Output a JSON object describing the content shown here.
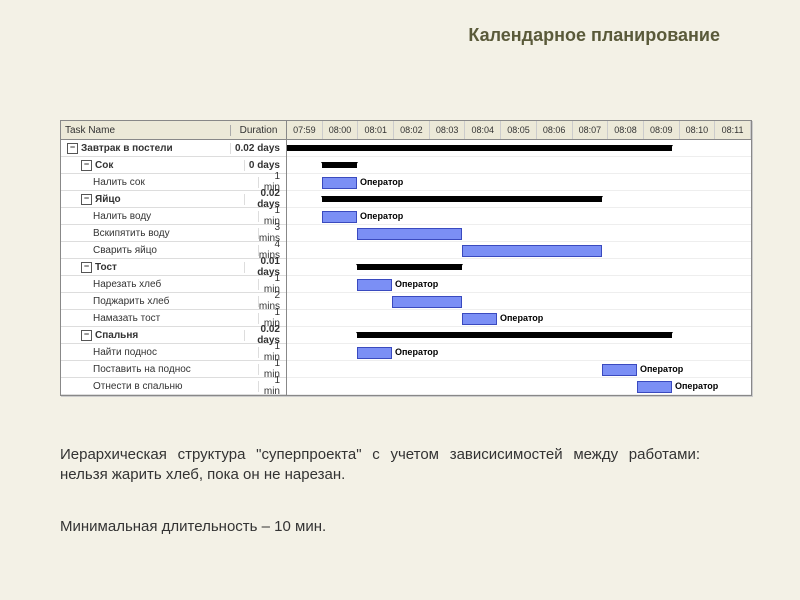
{
  "title": "Календарное планирование",
  "columns": {
    "name": "Task Name",
    "duration": "Duration"
  },
  "timeHeader": [
    "07:59",
    "08:00",
    "08:01",
    "08:02",
    "08:03",
    "08:04",
    "08:05",
    "08:06",
    "08:07",
    "08:08",
    "08:09",
    "08:10",
    "08:11"
  ],
  "resourceLabel": "Оператор",
  "tasks": [
    {
      "level": 0,
      "name": "Завтрак в постели",
      "duration": "0.02 days",
      "type": "summary",
      "start": 0,
      "len": 11
    },
    {
      "level": 1,
      "name": "Сок",
      "duration": "0 days",
      "type": "summary",
      "start": 1,
      "len": 1
    },
    {
      "level": 2,
      "name": "Налить сок",
      "duration": "1 min",
      "type": "task",
      "start": 1,
      "len": 1,
      "label": true
    },
    {
      "level": 1,
      "name": "Яйцо",
      "duration": "0.02 days",
      "type": "summary",
      "start": 1,
      "len": 8
    },
    {
      "level": 2,
      "name": "Налить воду",
      "duration": "1 min",
      "type": "task",
      "start": 1,
      "len": 1,
      "label": true
    },
    {
      "level": 2,
      "name": "Вскипятить воду",
      "duration": "3 mins",
      "type": "task",
      "start": 2,
      "len": 3
    },
    {
      "level": 2,
      "name": "Сварить яйцо",
      "duration": "4 mins",
      "type": "task",
      "start": 5,
      "len": 4
    },
    {
      "level": 1,
      "name": "Тост",
      "duration": "0.01 days",
      "type": "summary",
      "start": 2,
      "len": 3
    },
    {
      "level": 2,
      "name": "Нарезать хлеб",
      "duration": "1 min",
      "type": "task",
      "start": 2,
      "len": 1,
      "label": true
    },
    {
      "level": 2,
      "name": "Поджарить хлеб",
      "duration": "2 mins",
      "type": "task",
      "start": 3,
      "len": 2
    },
    {
      "level": 2,
      "name": "Намазать тост",
      "duration": "1 min",
      "type": "task",
      "start": 5,
      "len": 1,
      "label": true
    },
    {
      "level": 1,
      "name": "Спальня",
      "duration": "0.02 days",
      "type": "summary",
      "start": 2,
      "len": 9
    },
    {
      "level": 2,
      "name": "Найти поднос",
      "duration": "1 min",
      "type": "task",
      "start": 2,
      "len": 1,
      "label": true
    },
    {
      "level": 2,
      "name": "Поставить на поднос",
      "duration": "1 min",
      "type": "task",
      "start": 9,
      "len": 1,
      "label": true
    },
    {
      "level": 2,
      "name": "Отнести в спальню",
      "duration": "1 min",
      "type": "task",
      "start": 10,
      "len": 1,
      "label": true
    }
  ],
  "caption1": "Иерархическая структура \"суперпроекта\" с учетом зависисимостей между работами: нельзя жарить хлеб, пока он не нарезан.",
  "caption2": "Минимальная длительность – 10 мин.",
  "chart_data": {
    "type": "gantt",
    "title": "Завтрак в постели",
    "time_axis": [
      "07:59",
      "08:00",
      "08:01",
      "08:02",
      "08:03",
      "08:04",
      "08:05",
      "08:06",
      "08:07",
      "08:08",
      "08:09",
      "08:10",
      "08:11"
    ],
    "unit": "min",
    "tasks": [
      {
        "name": "Налить сок",
        "start": "08:00",
        "end": "08:01",
        "resource": "Оператор"
      },
      {
        "name": "Налить воду",
        "start": "08:00",
        "end": "08:01",
        "resource": "Оператор"
      },
      {
        "name": "Вскипятить воду",
        "start": "08:01",
        "end": "08:04"
      },
      {
        "name": "Сварить яйцо",
        "start": "08:04",
        "end": "08:08"
      },
      {
        "name": "Нарезать хлеб",
        "start": "08:01",
        "end": "08:02",
        "resource": "Оператор"
      },
      {
        "name": "Поджарить хлеб",
        "start": "08:02",
        "end": "08:04"
      },
      {
        "name": "Намазать тост",
        "start": "08:04",
        "end": "08:05",
        "resource": "Оператор"
      },
      {
        "name": "Найти поднос",
        "start": "08:01",
        "end": "08:02",
        "resource": "Оператор"
      },
      {
        "name": "Поставить на поднос",
        "start": "08:08",
        "end": "08:09",
        "resource": "Оператор"
      },
      {
        "name": "Отнести в спальню",
        "start": "08:09",
        "end": "08:10",
        "resource": "Оператор"
      }
    ]
  }
}
